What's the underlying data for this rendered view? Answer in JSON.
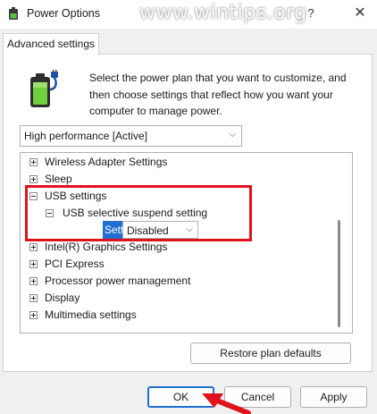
{
  "window": {
    "title": "Power Options",
    "help_glyph": "?",
    "close_glyph": "✕",
    "title_icon": "power-options-icon"
  },
  "watermark": "www.wintips.org",
  "tab": {
    "label": "Advanced settings"
  },
  "description": "Select the power plan that you want to customize, and then choose settings that reflect how you want your computer to manage power.",
  "plan_select": {
    "value": "High performance [Active]",
    "icon": "chevron-down-icon"
  },
  "tree": {
    "items": [
      {
        "label": "Wireless Adapter Settings",
        "state": "collapsed"
      },
      {
        "label": "Sleep",
        "state": "collapsed"
      },
      {
        "label": "USB settings",
        "state": "expanded"
      },
      {
        "label": "USB selective suspend setting",
        "state": "expanded"
      },
      {
        "label": "Intel(R) Graphics Settings",
        "state": "collapsed"
      },
      {
        "label": "PCI Express",
        "state": "collapsed"
      },
      {
        "label": "Processor power management",
        "state": "collapsed"
      },
      {
        "label": "Display",
        "state": "collapsed"
      },
      {
        "label": "Multimedia settings",
        "state": "collapsed"
      }
    ],
    "setting": {
      "label": "Setting:",
      "value": "Disabled"
    }
  },
  "buttons": {
    "restore": "Restore plan defaults",
    "ok": "OK",
    "cancel": "Cancel",
    "apply": "Apply"
  },
  "colors": {
    "accent": "#1f6fd1",
    "highlight_red": "#e0131c"
  }
}
